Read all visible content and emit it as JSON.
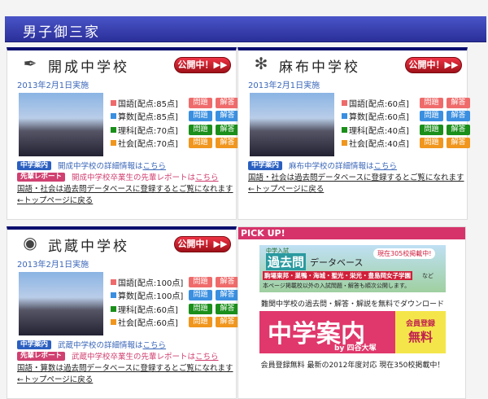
{
  "header": {
    "title": "男子御三家"
  },
  "schools": [
    {
      "name": "開成中学校",
      "logo": "✒",
      "open": "公開中！▶▶",
      "date": "2013年2月1日実施",
      "subjects": [
        {
          "label": "国語[配点:85点]",
          "color": "#ef6b6b"
        },
        {
          "label": "算数[配点:85点]",
          "color": "#3a8fe0"
        },
        {
          "label": "理科[配点:70点]",
          "color": "#1a8f1a"
        },
        {
          "label": "社会[配点:70点]",
          "color": "#f0961e"
        }
      ],
      "q": "問題",
      "a": "解答",
      "guide_tag": "中学案内",
      "guide_text": "開成中学校の詳細情報は",
      "here": "こちら",
      "report_tag": "先輩レポート",
      "report_text": "開成中学校卒業生の先輩レポートは",
      "note": "国語・社会は過去問データベースに登録するとご覧になれます",
      "back": "←トップページに戻る"
    },
    {
      "name": "麻布中学校",
      "logo": "✻",
      "open": "公開中！▶▶",
      "date": "2013年2月1日実施",
      "subjects": [
        {
          "label": "国語[配点:60点]",
          "color": "#ef6b6b"
        },
        {
          "label": "算数[配点:60点]",
          "color": "#3a8fe0"
        },
        {
          "label": "理科[配点:40点]",
          "color": "#1a8f1a"
        },
        {
          "label": "社会[配点:40点]",
          "color": "#f0961e"
        }
      ],
      "q": "問題",
      "a": "解答",
      "guide_tag": "中学案内",
      "guide_text": "麻布中学校の詳細情報は",
      "here": "こちら",
      "note": "国語・社会は過去問データベースに登録するとご覧になれます",
      "back": "←トップページに戻る"
    },
    {
      "name": "武蔵中学校",
      "logo": "◉",
      "open": "公開中！▶▶",
      "date": "2013年2月1日実施",
      "subjects": [
        {
          "label": "国語[配点:100点]",
          "color": "#ef6b6b"
        },
        {
          "label": "算数[配点:100点]",
          "color": "#3a8fe0"
        },
        {
          "label": "理科[配点:60点]",
          "color": "#1a8f1a"
        },
        {
          "label": "社会[配点:60点]",
          "color": "#f0961e"
        }
      ],
      "q": "問題",
      "a": "解答",
      "guide_tag": "中学案内",
      "guide_text": "武蔵中学校の詳細情報は",
      "here": "こちら",
      "report_tag": "先輩レポート",
      "report_text": "武蔵中学校卒業生の先輩レポートは",
      "note": "国語・算数は過去問データベースに登録するとご覧になれます",
      "back": "←トップページに戻る"
    }
  ],
  "pickup": {
    "title": "PICK UP!",
    "banner1": {
      "kicker": "中学入試",
      "title": "過去問",
      "sub": "データベース",
      "badge": "現在305校掲載中!",
      "schools": "駒場東邦・巣鴨・海城・聖光・栄光・豊島岡女子学園",
      "nado": "など",
      "line": "本ページ掲載校以外の入試問題・解答も順次公開します。"
    },
    "caption1": "難関中学校の過去問・解答・解説を無料でダウンロード",
    "banner2": {
      "title": "中学案内",
      "by": "by 四谷大塚",
      "badge1": "会員登録",
      "badge2": "無料"
    },
    "caption2": "会員登録無料 最新の2012年度対応 現在350校掲載中！"
  }
}
